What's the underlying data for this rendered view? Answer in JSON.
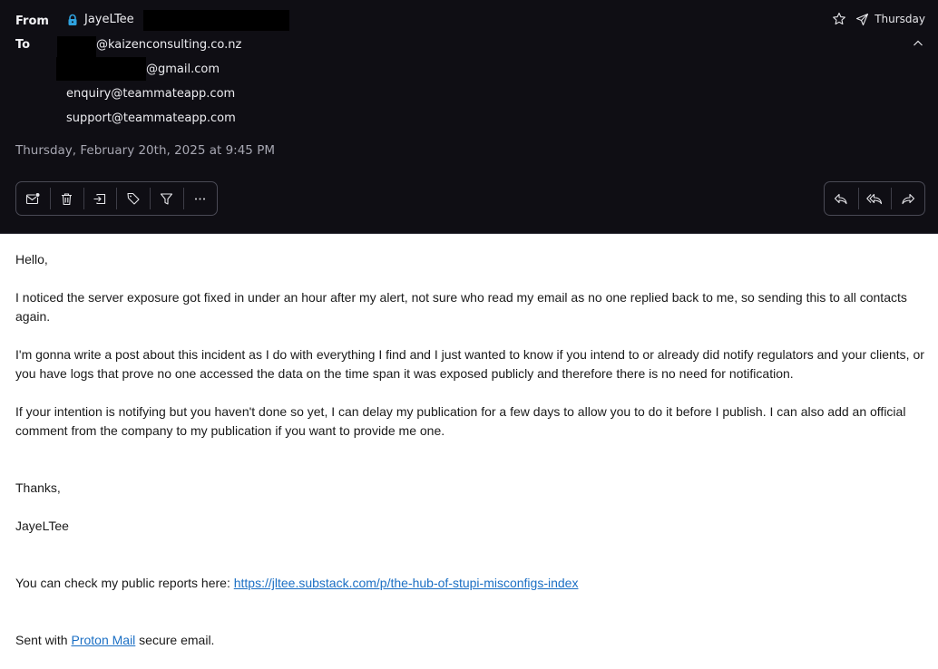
{
  "header": {
    "from_label": "From",
    "to_label": "To",
    "sender": {
      "name": "JayeLTee",
      "lock_color": "#2fa3e0"
    },
    "recipients": [
      "@kaizenconsulting.co.nz",
      "@gmail.com",
      "enquiry@teammateapp.com",
      "support@teammateapp.com"
    ],
    "date_full": "Thursday, February 20th, 2025 at 9:45 PM",
    "date_short": "Thursday",
    "icons": {
      "star": "star-icon",
      "sent": "paper-plane-icon",
      "collapse": "chevron-up-icon"
    }
  },
  "toolbar_left": [
    {
      "name": "mark-unread-button",
      "icon": "envelope-dot-icon"
    },
    {
      "name": "trash-button",
      "icon": "trash-icon"
    },
    {
      "name": "move-button",
      "icon": "move-to-folder-icon"
    },
    {
      "name": "label-button",
      "icon": "tag-icon"
    },
    {
      "name": "filter-button",
      "icon": "filter-icon"
    },
    {
      "name": "more-button",
      "icon": "more-dots-icon"
    }
  ],
  "toolbar_right": [
    {
      "name": "reply-button",
      "icon": "reply-icon"
    },
    {
      "name": "reply-all-button",
      "icon": "reply-all-icon"
    },
    {
      "name": "forward-button",
      "icon": "forward-icon"
    }
  ],
  "message": {
    "greeting": "Hello,",
    "p1": "I noticed the server exposure got fixed in under an hour after my alert, not sure who read my email as no one replied back to me, so sending this to all contacts again.",
    "p2": "I'm gonna write a post about this incident as I do with everything I find and I just wanted to know if you intend to or already did notify regulators and your clients, or you have logs that prove no one accessed the data on the time span it was exposed publicly and therefore there is no need for notification.",
    "p3": "If your intention is notifying but you haven't done so yet, I can delay my publication for a few days to allow you to do it before I publish. I can also add an official comment from the company to my publication if you want to provide me one.",
    "thanks": "Thanks,",
    "signature": "JayeLTee",
    "reports_prefix": "You can check my public reports here: ",
    "reports_link": "https://jltee.substack.com/p/the-hub-of-stupi-misconfigs-index",
    "sent_prefix": "Sent with ",
    "sent_link": "Proton Mail",
    "sent_suffix": " secure email.",
    "link_color": "#1b6fc4"
  }
}
